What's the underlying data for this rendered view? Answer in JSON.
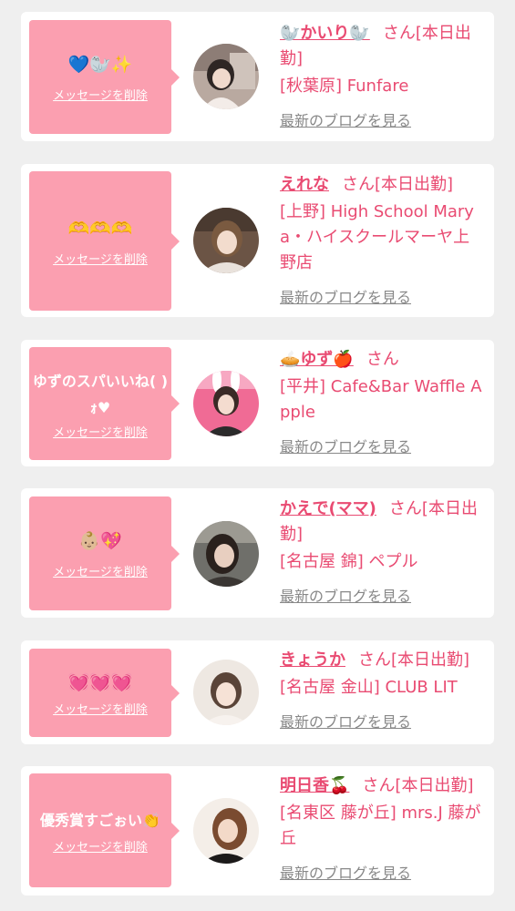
{
  "colors": {
    "accent": "#e94b72",
    "bubble": "#fb9fb0",
    "link_gray": "#888888",
    "background": "#efefef"
  },
  "delete_label": "メッセージを削除",
  "blog_label": "最新のブログを見る",
  "cards": [
    {
      "message": "💙🦭✨",
      "name": "🦭かいり🦭",
      "san": "さん[本日出勤]",
      "shop": "[秋葉原] Funfare"
    },
    {
      "message": "🫶🫶🫶",
      "name": "えれな",
      "san": "さん[本日出勤]",
      "shop": "[上野] High School Marya・ハイスクールマーヤ上野店"
    },
    {
      "message": "ゆずのスパいいね( )ｫ♥",
      "name": "🥧ゆず🍎",
      "san": "さん",
      "shop": "[平井] Cafe&Bar Waffle Apple"
    },
    {
      "message": "👶🏼💖",
      "name": "かえで(ママ)",
      "san": "さん[本日出勤]",
      "shop": "[名古屋 錦] ペプル"
    },
    {
      "message": "💓💓💓",
      "name": "きょうか",
      "san": "さん[本日出勤]",
      "shop": "[名古屋 金山] CLUB LIT"
    },
    {
      "message": "優秀賞すごぉい👏",
      "name": "明日香🍒",
      "san": "さん[本日出勤]",
      "shop": "[名東区 藤が丘] mrs.J 藤が丘"
    }
  ]
}
